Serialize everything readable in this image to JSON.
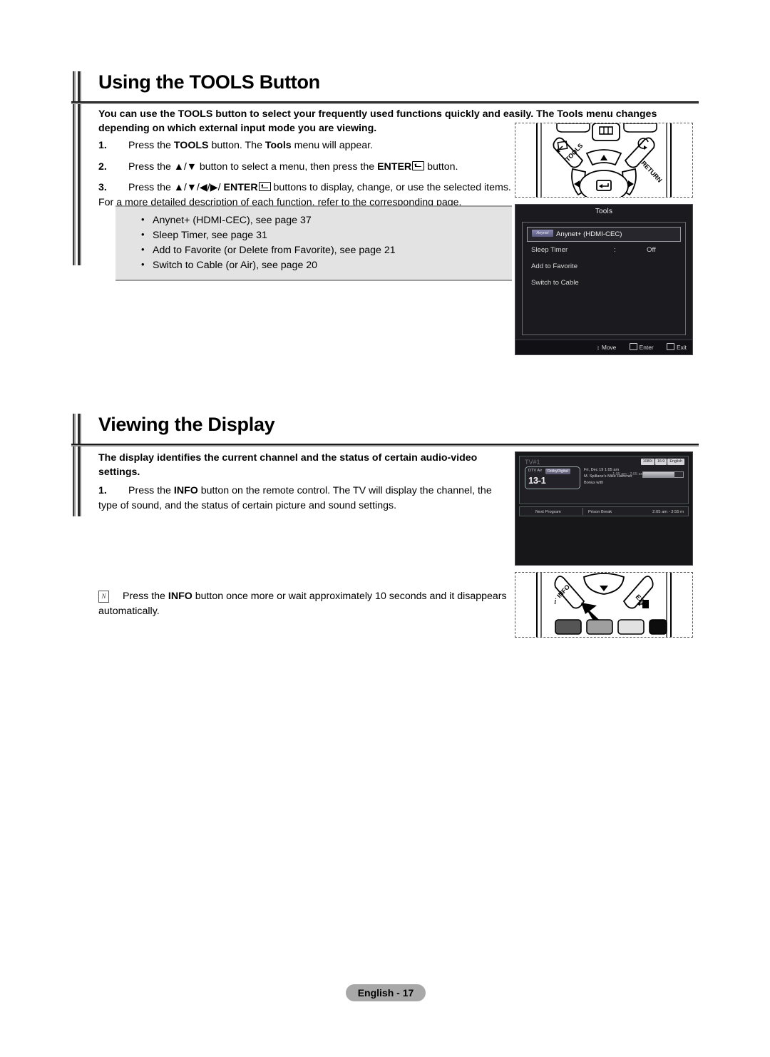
{
  "sections": [
    {
      "id": "tools",
      "title": "Using the TOOLS Button",
      "intro": "You can use the TOOLS button to select your frequently used functions quickly and easily. The Tools menu changes depending on which external input mode you are viewing.",
      "steps": [
        {
          "num": "1.",
          "pre": "Press the ",
          "bold1": "TOOLS",
          "mid": " button. The ",
          "bold2": "Tools",
          "post": " menu will appear."
        },
        {
          "num": "2.",
          "pre": "Press the ▲/▼ button to select a menu, then press the ",
          "bold1": "ENTER",
          "post": " button."
        },
        {
          "num": "3.",
          "pre": "Press the ▲/▼/◀/▶/ ",
          "bold1": "ENTER",
          "post": " buttons to display, change, or use the selected items. For a more detailed description of each function, refer to the corresponding page."
        }
      ],
      "bullets": [
        "Anynet+ (HDMI-CEC), see page 37",
        "Sleep Timer, see page 31",
        "Add to Favorite (or Delete from Favorite), see page 21",
        "Switch to Cable (or Air), see page 20"
      ]
    },
    {
      "id": "display",
      "title": "Viewing the Display",
      "intro": "The display identifies the current channel and the status of certain audio-video settings.",
      "steps": [
        {
          "num": "1.",
          "pre": "Press the ",
          "bold1": "INFO",
          "post": " button on the remote control. The TV will display the channel, the type of sound, and the status of certain picture and sound settings."
        }
      ],
      "note": {
        "pre": "Press the ",
        "bold1": "INFO",
        "post": " button once more or wait approximately 10 seconds and it disappears automatically."
      }
    }
  ],
  "tools_osd": {
    "title": "Tools",
    "rows": [
      {
        "label": "Anynet+ (HDMI-CEC)",
        "badge": "Anynet",
        "colon": "",
        "value": "",
        "selected": true
      },
      {
        "label": "Sleep Timer",
        "badge": "",
        "colon": ":",
        "value": "Off",
        "selected": false
      },
      {
        "label": "Add to Favorite",
        "badge": "",
        "colon": "",
        "value": "",
        "selected": false
      },
      {
        "label": "Switch to Cable",
        "badge": "",
        "colon": "",
        "value": "",
        "selected": false
      }
    ],
    "footer": {
      "move": "Move",
      "enter": "Enter",
      "exit": "Exit"
    }
  },
  "info_osd": {
    "tv_name": "TV#1",
    "source": "DTV Air",
    "audio_badge": "DolbyDigital",
    "channel": "13-1",
    "meta_line1": "Fri, Dec 19  1:05 am",
    "meta_line2": "M. Spillane's Mike Hammer",
    "meta_line3": "Bonus with",
    "time_range": "1:05 am - 2:05 am",
    "badges": [
      "1080i",
      "16:9",
      "English"
    ],
    "next_label": "Next Program",
    "next_program": "Prison Break",
    "next_time": "2:05 am - 3:55 m"
  },
  "remote_top": {
    "buttons": [
      "TOOLS",
      "RETURN"
    ],
    "dpad": [
      "up",
      "down",
      "left",
      "right",
      "enter"
    ]
  },
  "remote_bottom": {
    "buttons": [
      "INFO",
      "EXIT"
    ],
    "color_keys": [
      "red",
      "green",
      "yellow",
      "blue"
    ]
  },
  "footer": {
    "page_label": "English - 17"
  },
  "colors": {
    "rule_dark": "#1a1a1a",
    "rule_light": "#8f8f8f",
    "bullet_bg": "#e3e3e3",
    "osd_bg": "#1b1b1f",
    "footer_pill": "#a8a8a8"
  }
}
